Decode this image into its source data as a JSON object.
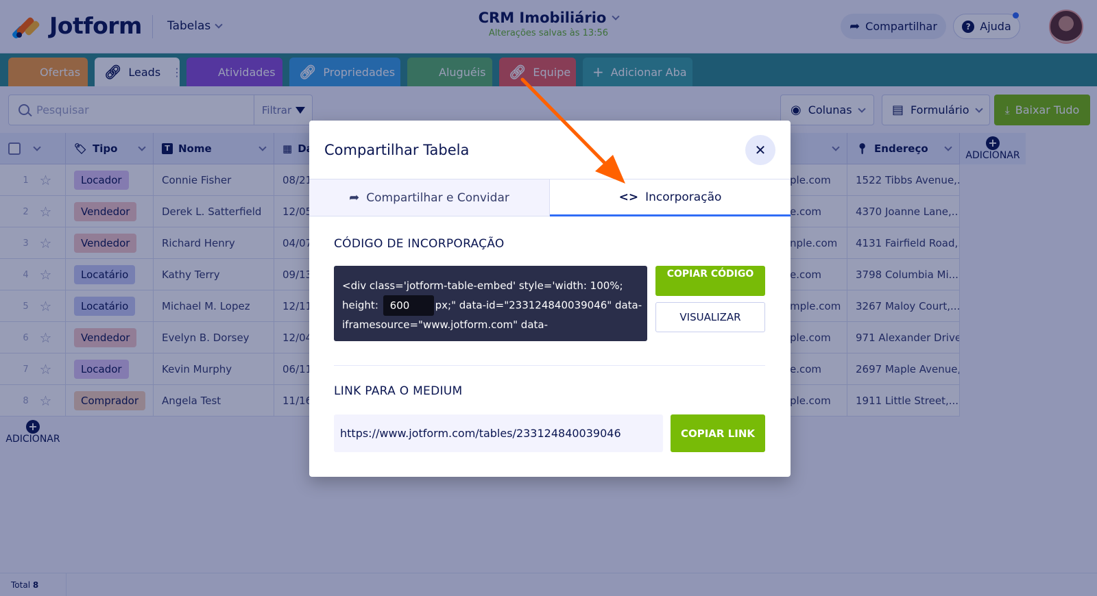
{
  "header": {
    "logo_text": "Jotform",
    "tables_label": "Tabelas",
    "title": "CRM Imobiliário",
    "subtitle": "Alterações salvas às 13:56",
    "share_label": "Compartilhar",
    "help_label": "Ajuda"
  },
  "tabs": [
    {
      "label": "Ofertas",
      "icon": "grid-icon",
      "color": "#f39c3c"
    },
    {
      "label": "Leads",
      "icon": "link-icon",
      "color": "#ffffff"
    },
    {
      "label": "Atividades",
      "icon": "grid-icon",
      "color": "#8a4fd6"
    },
    {
      "label": "Propriedades",
      "icon": "link-icon",
      "color": "#3aa0e6"
    },
    {
      "label": "Aluguéis",
      "icon": "grid-icon",
      "color": "#5ab26a"
    },
    {
      "label": "Equipe",
      "icon": "link-icon",
      "color": "#e45b5b"
    },
    {
      "label": "Adicionar Aba",
      "icon": "plus-icon",
      "color": "#2d8a8a"
    }
  ],
  "toolbar": {
    "search_placeholder": "Pesquisar",
    "filter_label": "Filtrar",
    "columns_label": "Colunas",
    "form_label": "Formulário",
    "download_label": "Baixar Tudo"
  },
  "table": {
    "headers": {
      "tipo": "Tipo",
      "nome": "Nome",
      "data": "Da",
      "email": "",
      "endereco": "Endereço",
      "add_col": "ADICIONAR"
    },
    "rows": [
      {
        "n": "1",
        "tipo": "Locador",
        "nome": "Connie Fisher",
        "data": "08/21",
        "email": "ple.com",
        "endereco": "1522 Tibbs Avenue,..."
      },
      {
        "n": "2",
        "tipo": "Vendedor",
        "nome": "Derek L. Satterfield",
        "data": "12/05",
        "email": "e.com",
        "endereco": "4370 Joanne Lane,..."
      },
      {
        "n": "3",
        "tipo": "Vendedor",
        "nome": "Richard Henry",
        "data": "04/07",
        "email": "nple.com",
        "endereco": "4131 Fairfield Road,..."
      },
      {
        "n": "4",
        "tipo": "Locatário",
        "nome": "Kathy Terry",
        "data": "09/13",
        "email": "e.com",
        "endereco": "3798 Columbia Mi..."
      },
      {
        "n": "5",
        "tipo": "Locatário",
        "nome": "Michael M. Lopez",
        "data": "12/11/",
        "email": "mple.com",
        "endereco": "3267 Maloy Court,..."
      },
      {
        "n": "6",
        "tipo": "Vendedor",
        "nome": "Evelyn B. Dorsey",
        "data": "12/04",
        "email": "ple.com",
        "endereco": "971 Alexander Drive,"
      },
      {
        "n": "7",
        "tipo": "Locador",
        "nome": "Kevin Murphy",
        "data": "06/11/",
        "email": "e.com",
        "endereco": "2697 Maple Avenue,"
      },
      {
        "n": "8",
        "tipo": "Comprador",
        "nome": "Angela Test",
        "data": "11/16/",
        "email": "ple.com",
        "endereco": "1911 Little Street,..."
      }
    ],
    "badge_colors": {
      "Locador": "#dcc4f5",
      "Vendedor": "#f5c9c9",
      "Locatário": "#c7ccf7",
      "Comprador": "#f7d2b8"
    },
    "add_row_label": "ADICIONAR",
    "footer_label": "Total",
    "footer_count": "8"
  },
  "modal": {
    "title": "Compartilhar Tabela",
    "tab_share": "Compartilhar e Convidar",
    "tab_embed": "Incorporação",
    "embed_section": "CÓDIGO DE INCORPORAÇÃO",
    "code_line1": "<div class='jotform-table-embed' style='width: 100%;",
    "code_height_label": "height:",
    "code_height_value": "600",
    "code_line2_rest": "px;\" data-id=\"233124840039046\" data-",
    "code_line3": "iframesource=\"www.jotform.com\" data-",
    "copy_code_label": "COPIAR CÓDIGO",
    "preview_label": "VISUALIZAR",
    "link_section": "LINK PARA O MEDIUM",
    "link_url": "https://www.jotform.com/tables/233124840039046",
    "copy_link_label": "COPIAR LINK"
  },
  "colors": {
    "accent_green": "#78bb07",
    "navy": "#0a1551",
    "teal_tabbar": "#2d8a8a",
    "active_tab_line": "#2f6cf6",
    "arrow": "#ff6100"
  }
}
